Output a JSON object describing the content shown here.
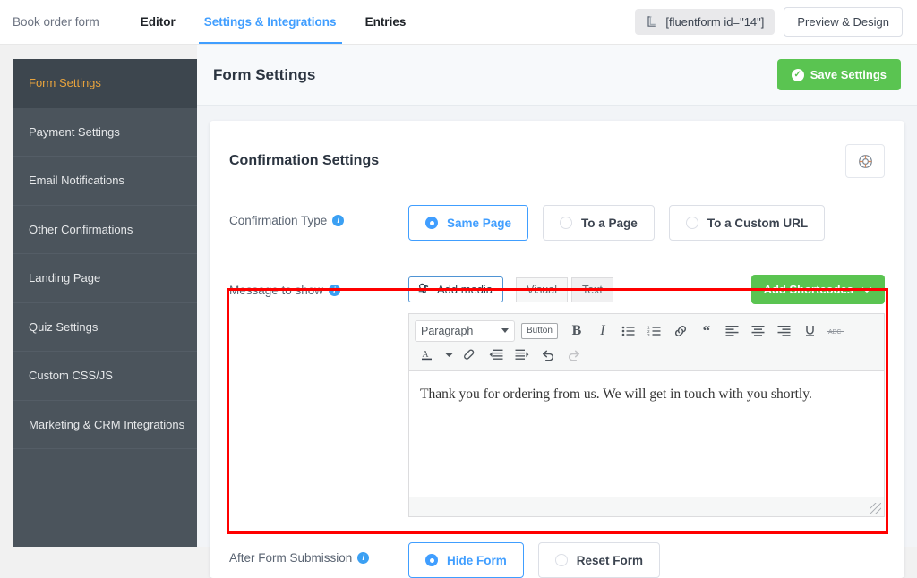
{
  "topbar": {
    "form_name": "Book order form",
    "nav": [
      {
        "label": "Editor",
        "state": "default"
      },
      {
        "label": "Settings & Integrations",
        "state": "active"
      },
      {
        "label": "Entries",
        "state": "default"
      }
    ],
    "shortcode_pill": "[fluentform id=\"14\"]",
    "preview_button": "Preview & Design"
  },
  "sidebar": {
    "items": [
      {
        "label": "Form Settings",
        "active": true
      },
      {
        "label": "Payment Settings",
        "active": false
      },
      {
        "label": "Email Notifications",
        "active": false
      },
      {
        "label": "Other Confirmations",
        "active": false
      },
      {
        "label": "Landing Page",
        "active": false
      },
      {
        "label": "Quiz Settings",
        "active": false
      },
      {
        "label": "Custom CSS/JS",
        "active": false
      },
      {
        "label": "Marketing & CRM Integrations",
        "active": false
      }
    ]
  },
  "main": {
    "page_title": "Form Settings",
    "save_button": "Save Settings",
    "card_title": "Confirmation Settings",
    "help_icon": "lifebuoy-icon",
    "confirmation_type": {
      "label": "Confirmation Type",
      "options": [
        {
          "label": "Same Page",
          "selected": true
        },
        {
          "label": "To a Page",
          "selected": false
        },
        {
          "label": "To a Custom URL",
          "selected": false
        }
      ]
    },
    "message_to_show": {
      "label": "Message to show",
      "add_media_button": "Add media",
      "editor_tabs": [
        {
          "label": "Visual",
          "active": true
        },
        {
          "label": "Text",
          "active": false
        }
      ],
      "add_shortcodes_button": "Add Shortcodes",
      "toolbar": {
        "format_select": "Paragraph",
        "button_chip": "Button",
        "row1_icons": [
          "bold-icon",
          "italic-icon",
          "bulleted-list-icon",
          "numbered-list-icon",
          "link-icon",
          "blockquote-icon",
          "align-left-icon",
          "align-center-icon",
          "align-right-icon",
          "underline-icon",
          "strikethrough-icon"
        ],
        "row2_icons": [
          "text-color-icon",
          "text-color-caret-icon",
          "clear-formatting-icon",
          "decrease-indent-icon",
          "increase-indent-icon",
          "undo-icon",
          "redo-icon"
        ]
      },
      "content": "Thank you for ordering from us. We will get in touch with you shortly."
    },
    "after_form_submission": {
      "label": "After Form Submission",
      "options": [
        {
          "label": "Hide Form",
          "selected": true
        },
        {
          "label": "Reset Form",
          "selected": false
        }
      ]
    }
  },
  "colors": {
    "accent_blue": "#409eff",
    "green": "#5ac451",
    "sidebar_bg": "#4b545c",
    "sidebar_active_text": "#e8a33d",
    "highlight_red": "#ff0000"
  }
}
